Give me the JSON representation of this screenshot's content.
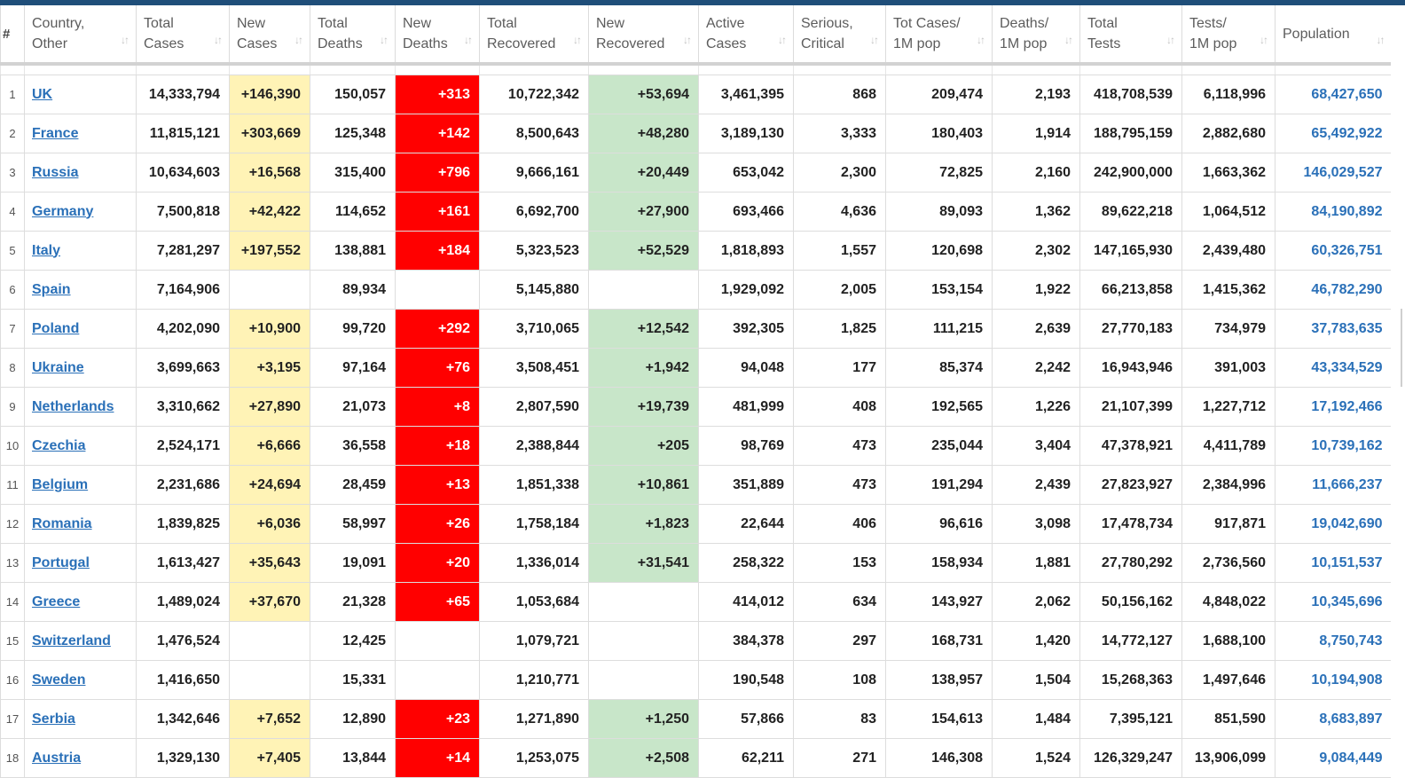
{
  "colors": {
    "topbar": "#1f4e79",
    "new_cases_highlight": "#fff3b6",
    "new_deaths_highlight": "#ff0000",
    "new_recovered_highlight": "#c8e6c9",
    "link": "#2a70b8"
  },
  "sort_icon": "sort-arrows-icon",
  "table": {
    "columns": [
      {
        "key": "rank",
        "label": "#",
        "sortable": false
      },
      {
        "key": "country",
        "label": "Country,\nOther",
        "sortable": true
      },
      {
        "key": "total_cases",
        "label": "Total\nCases",
        "sortable": true
      },
      {
        "key": "new_cases",
        "label": "New\nCases",
        "sortable": true
      },
      {
        "key": "total_deaths",
        "label": "Total\nDeaths",
        "sortable": true
      },
      {
        "key": "new_deaths",
        "label": "New\nDeaths",
        "sortable": true
      },
      {
        "key": "total_recovered",
        "label": "Total\nRecovered",
        "sortable": true
      },
      {
        "key": "new_recovered",
        "label": "New\nRecovered",
        "sortable": true
      },
      {
        "key": "active_cases",
        "label": "Active\nCases",
        "sortable": true
      },
      {
        "key": "serious_critical",
        "label": "Serious,\nCritical",
        "sortable": true
      },
      {
        "key": "tot_cases_1m",
        "label": "Tot Cases/\n1M pop",
        "sortable": true
      },
      {
        "key": "deaths_1m",
        "label": "Deaths/\n1M pop",
        "sortable": true
      },
      {
        "key": "total_tests",
        "label": "Total\nTests",
        "sortable": true
      },
      {
        "key": "tests_1m",
        "label": "Tests/\n1M pop",
        "sortable": true
      },
      {
        "key": "population",
        "label": "Population",
        "sortable": true
      }
    ],
    "rows": [
      {
        "rank": "1",
        "country": "UK",
        "total_cases": "14,333,794",
        "new_cases": "+146,390",
        "total_deaths": "150,057",
        "new_deaths": "+313",
        "total_recovered": "10,722,342",
        "new_recovered": "+53,694",
        "active_cases": "3,461,395",
        "serious_critical": "868",
        "tot_cases_1m": "209,474",
        "deaths_1m": "2,193",
        "total_tests": "418,708,539",
        "tests_1m": "6,118,996",
        "population": "68,427,650"
      },
      {
        "rank": "2",
        "country": "France",
        "total_cases": "11,815,121",
        "new_cases": "+303,669",
        "total_deaths": "125,348",
        "new_deaths": "+142",
        "total_recovered": "8,500,643",
        "new_recovered": "+48,280",
        "active_cases": "3,189,130",
        "serious_critical": "3,333",
        "tot_cases_1m": "180,403",
        "deaths_1m": "1,914",
        "total_tests": "188,795,159",
        "tests_1m": "2,882,680",
        "population": "65,492,922"
      },
      {
        "rank": "3",
        "country": "Russia",
        "total_cases": "10,634,603",
        "new_cases": "+16,568",
        "total_deaths": "315,400",
        "new_deaths": "+796",
        "total_recovered": "9,666,161",
        "new_recovered": "+20,449",
        "active_cases": "653,042",
        "serious_critical": "2,300",
        "tot_cases_1m": "72,825",
        "deaths_1m": "2,160",
        "total_tests": "242,900,000",
        "tests_1m": "1,663,362",
        "population": "146,029,527"
      },
      {
        "rank": "4",
        "country": "Germany",
        "total_cases": "7,500,818",
        "new_cases": "+42,422",
        "total_deaths": "114,652",
        "new_deaths": "+161",
        "total_recovered": "6,692,700",
        "new_recovered": "+27,900",
        "active_cases": "693,466",
        "serious_critical": "4,636",
        "tot_cases_1m": "89,093",
        "deaths_1m": "1,362",
        "total_tests": "89,622,218",
        "tests_1m": "1,064,512",
        "population": "84,190,892"
      },
      {
        "rank": "5",
        "country": "Italy",
        "total_cases": "7,281,297",
        "new_cases": "+197,552",
        "total_deaths": "138,881",
        "new_deaths": "+184",
        "total_recovered": "5,323,523",
        "new_recovered": "+52,529",
        "active_cases": "1,818,893",
        "serious_critical": "1,557",
        "tot_cases_1m": "120,698",
        "deaths_1m": "2,302",
        "total_tests": "147,165,930",
        "tests_1m": "2,439,480",
        "population": "60,326,751"
      },
      {
        "rank": "6",
        "country": "Spain",
        "total_cases": "7,164,906",
        "new_cases": "",
        "total_deaths": "89,934",
        "new_deaths": "",
        "total_recovered": "5,145,880",
        "new_recovered": "",
        "active_cases": "1,929,092",
        "serious_critical": "2,005",
        "tot_cases_1m": "153,154",
        "deaths_1m": "1,922",
        "total_tests": "66,213,858",
        "tests_1m": "1,415,362",
        "population": "46,782,290"
      },
      {
        "rank": "7",
        "country": "Poland",
        "total_cases": "4,202,090",
        "new_cases": "+10,900",
        "total_deaths": "99,720",
        "new_deaths": "+292",
        "total_recovered": "3,710,065",
        "new_recovered": "+12,542",
        "active_cases": "392,305",
        "serious_critical": "1,825",
        "tot_cases_1m": "111,215",
        "deaths_1m": "2,639",
        "total_tests": "27,770,183",
        "tests_1m": "734,979",
        "population": "37,783,635"
      },
      {
        "rank": "8",
        "country": "Ukraine",
        "total_cases": "3,699,663",
        "new_cases": "+3,195",
        "total_deaths": "97,164",
        "new_deaths": "+76",
        "total_recovered": "3,508,451",
        "new_recovered": "+1,942",
        "active_cases": "94,048",
        "serious_critical": "177",
        "tot_cases_1m": "85,374",
        "deaths_1m": "2,242",
        "total_tests": "16,943,946",
        "tests_1m": "391,003",
        "population": "43,334,529"
      },
      {
        "rank": "9",
        "country": "Netherlands",
        "total_cases": "3,310,662",
        "new_cases": "+27,890",
        "total_deaths": "21,073",
        "new_deaths": "+8",
        "total_recovered": "2,807,590",
        "new_recovered": "+19,739",
        "active_cases": "481,999",
        "serious_critical": "408",
        "tot_cases_1m": "192,565",
        "deaths_1m": "1,226",
        "total_tests": "21,107,399",
        "tests_1m": "1,227,712",
        "population": "17,192,466"
      },
      {
        "rank": "10",
        "country": "Czechia",
        "total_cases": "2,524,171",
        "new_cases": "+6,666",
        "total_deaths": "36,558",
        "new_deaths": "+18",
        "total_recovered": "2,388,844",
        "new_recovered": "+205",
        "active_cases": "98,769",
        "serious_critical": "473",
        "tot_cases_1m": "235,044",
        "deaths_1m": "3,404",
        "total_tests": "47,378,921",
        "tests_1m": "4,411,789",
        "population": "10,739,162"
      },
      {
        "rank": "11",
        "country": "Belgium",
        "total_cases": "2,231,686",
        "new_cases": "+24,694",
        "total_deaths": "28,459",
        "new_deaths": "+13",
        "total_recovered": "1,851,338",
        "new_recovered": "+10,861",
        "active_cases": "351,889",
        "serious_critical": "473",
        "tot_cases_1m": "191,294",
        "deaths_1m": "2,439",
        "total_tests": "27,823,927",
        "tests_1m": "2,384,996",
        "population": "11,666,237"
      },
      {
        "rank": "12",
        "country": "Romania",
        "total_cases": "1,839,825",
        "new_cases": "+6,036",
        "total_deaths": "58,997",
        "new_deaths": "+26",
        "total_recovered": "1,758,184",
        "new_recovered": "+1,823",
        "active_cases": "22,644",
        "serious_critical": "406",
        "tot_cases_1m": "96,616",
        "deaths_1m": "3,098",
        "total_tests": "17,478,734",
        "tests_1m": "917,871",
        "population": "19,042,690"
      },
      {
        "rank": "13",
        "country": "Portugal",
        "total_cases": "1,613,427",
        "new_cases": "+35,643",
        "total_deaths": "19,091",
        "new_deaths": "+20",
        "total_recovered": "1,336,014",
        "new_recovered": "+31,541",
        "active_cases": "258,322",
        "serious_critical": "153",
        "tot_cases_1m": "158,934",
        "deaths_1m": "1,881",
        "total_tests": "27,780,292",
        "tests_1m": "2,736,560",
        "population": "10,151,537"
      },
      {
        "rank": "14",
        "country": "Greece",
        "total_cases": "1,489,024",
        "new_cases": "+37,670",
        "total_deaths": "21,328",
        "new_deaths": "+65",
        "total_recovered": "1,053,684",
        "new_recovered": "",
        "active_cases": "414,012",
        "serious_critical": "634",
        "tot_cases_1m": "143,927",
        "deaths_1m": "2,062",
        "total_tests": "50,156,162",
        "tests_1m": "4,848,022",
        "population": "10,345,696"
      },
      {
        "rank": "15",
        "country": "Switzerland",
        "total_cases": "1,476,524",
        "new_cases": "",
        "total_deaths": "12,425",
        "new_deaths": "",
        "total_recovered": "1,079,721",
        "new_recovered": "",
        "active_cases": "384,378",
        "serious_critical": "297",
        "tot_cases_1m": "168,731",
        "deaths_1m": "1,420",
        "total_tests": "14,772,127",
        "tests_1m": "1,688,100",
        "population": "8,750,743"
      },
      {
        "rank": "16",
        "country": "Sweden",
        "total_cases": "1,416,650",
        "new_cases": "",
        "total_deaths": "15,331",
        "new_deaths": "",
        "total_recovered": "1,210,771",
        "new_recovered": "",
        "active_cases": "190,548",
        "serious_critical": "108",
        "tot_cases_1m": "138,957",
        "deaths_1m": "1,504",
        "total_tests": "15,268,363",
        "tests_1m": "1,497,646",
        "population": "10,194,908"
      },
      {
        "rank": "17",
        "country": "Serbia",
        "total_cases": "1,342,646",
        "new_cases": "+7,652",
        "total_deaths": "12,890",
        "new_deaths": "+23",
        "total_recovered": "1,271,890",
        "new_recovered": "+1,250",
        "active_cases": "57,866",
        "serious_critical": "83",
        "tot_cases_1m": "154,613",
        "deaths_1m": "1,484",
        "total_tests": "7,395,121",
        "tests_1m": "851,590",
        "population": "8,683,897"
      },
      {
        "rank": "18",
        "country": "Austria",
        "total_cases": "1,329,130",
        "new_cases": "+7,405",
        "total_deaths": "13,844",
        "new_deaths": "+14",
        "total_recovered": "1,253,075",
        "new_recovered": "+2,508",
        "active_cases": "62,211",
        "serious_critical": "271",
        "tot_cases_1m": "146,308",
        "deaths_1m": "1,524",
        "total_tests": "126,329,247",
        "tests_1m": "13,906,099",
        "population": "9,084,449"
      }
    ]
  }
}
